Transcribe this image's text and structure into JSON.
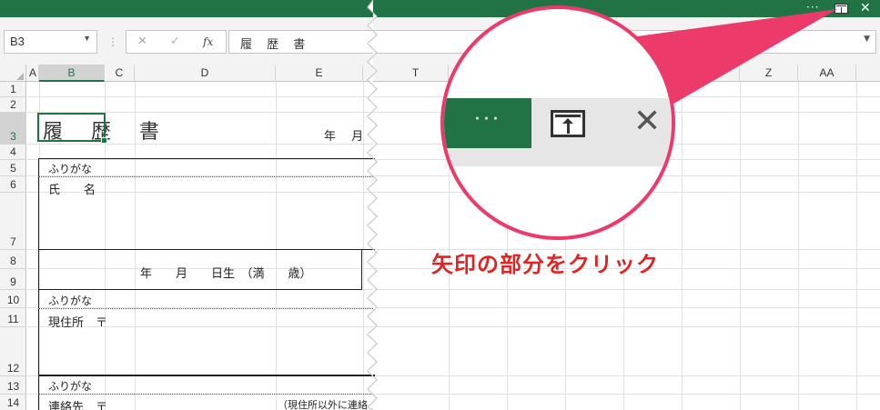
{
  "titlebar": {
    "more_label": "···",
    "close_label": "✕"
  },
  "formula_bar": {
    "name_box": "B3",
    "cancel_label": "✕",
    "enter_label": "✓",
    "fx_label": "fx",
    "content": "履 歴 書"
  },
  "columns_left": [
    "A",
    "B",
    "C",
    "D",
    "E"
  ],
  "columns_right": [
    "T",
    "Z",
    "AA"
  ],
  "rows": [
    "1",
    "2",
    "3",
    "4",
    "5",
    "6",
    "7",
    "8",
    "9",
    "10",
    "11",
    "12",
    "13",
    "14"
  ],
  "sheet": {
    "title": "履 歴 書",
    "year_month": "年　 月",
    "furigana_1": "ふりがな",
    "name_label": "氏　　名",
    "birth_line": "年　　月　　日生　（満　　歳）",
    "furigana_2": "ふりがな",
    "address_label": "現住所　〒",
    "furigana_3": "ふりがな",
    "contact_label": "連絡先　〒",
    "contact_note": "（現住所以外に連絡"
  },
  "lens": {
    "more_label": "···",
    "close_label": "✕"
  },
  "callout": "矢印の部分をクリック",
  "colors": {
    "excel_green": "#217346",
    "highlight_pink": "#ec3a6b",
    "callout_red": "#e02424"
  },
  "icons": [
    "more-options-icon",
    "restore-ribbon-icon",
    "close-icon",
    "fx-icon",
    "dropdown-icon"
  ]
}
